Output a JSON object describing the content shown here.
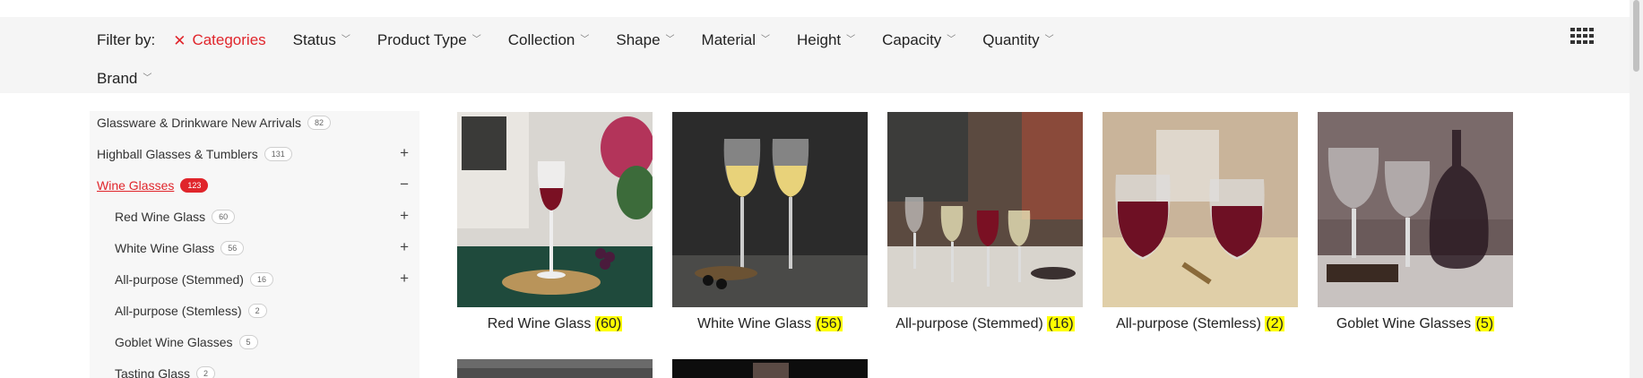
{
  "filters": {
    "label": "Filter by:",
    "active": "Categories",
    "items": [
      "Status",
      "Product Type",
      "Collection",
      "Shape",
      "Material",
      "Height",
      "Capacity",
      "Quantity"
    ],
    "row2": [
      "Brand"
    ]
  },
  "sidebar": {
    "categories": [
      {
        "name": "Glassware & Drinkware New Arrivals",
        "count": "82"
      },
      {
        "name": "Highball Glasses & Tumblers",
        "count": "131",
        "toggle": "+"
      },
      {
        "name": "Wine Glasses",
        "count": "123",
        "toggle": "−"
      },
      {
        "name": "Red Wine Glass",
        "count": "60",
        "toggle": "+"
      },
      {
        "name": "White Wine Glass",
        "count": "56",
        "toggle": "+"
      },
      {
        "name": "All-purpose (Stemmed)",
        "count": "16",
        "toggle": "+"
      },
      {
        "name": "All-purpose (Stemless)",
        "count": "2"
      },
      {
        "name": "Goblet Wine Glasses",
        "count": "5"
      },
      {
        "name": "Tasting Glass",
        "count": "2"
      }
    ]
  },
  "products": [
    {
      "name": "Red Wine Glass",
      "count": "(60)"
    },
    {
      "name": "White Wine Glass",
      "count": "(56)"
    },
    {
      "name": "All-purpose (Stemmed)",
      "count": "(16)"
    },
    {
      "name": "All-purpose (Stemless)",
      "count": "(2)"
    },
    {
      "name": "Goblet Wine Glasses",
      "count": "(5)"
    }
  ],
  "icons": {
    "grid": "grid-view-icon",
    "close": "close-icon",
    "chevron": "chevron-down-icon"
  },
  "colors": {
    "accent": "#e0252b",
    "highlight": "#ffff00",
    "bar_bg": "#f5f5f5"
  }
}
